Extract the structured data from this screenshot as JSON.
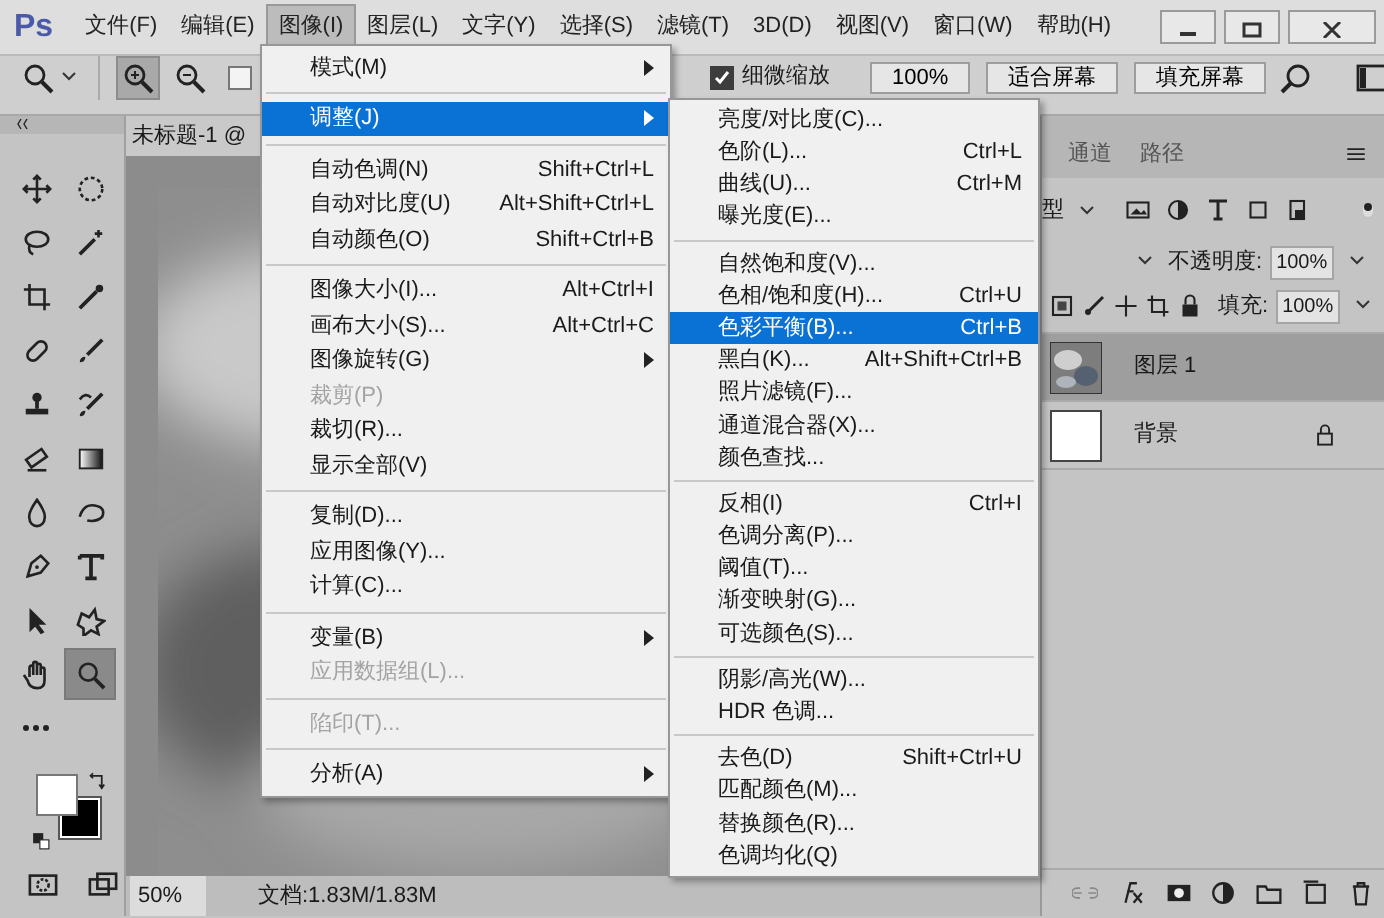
{
  "app_logo": "Ps",
  "menu_bar": [
    {
      "label": "文件(F)",
      "selected": false
    },
    {
      "label": "编辑(E)",
      "selected": false
    },
    {
      "label": "图像(I)",
      "selected": true
    },
    {
      "label": "图层(L)",
      "selected": false
    },
    {
      "label": "文字(Y)",
      "selected": false
    },
    {
      "label": "选择(S)",
      "selected": false
    },
    {
      "label": "滤镜(T)",
      "selected": false
    },
    {
      "label": "3D(D)",
      "selected": false
    },
    {
      "label": "视图(V)",
      "selected": false
    },
    {
      "label": "窗口(W)",
      "selected": false
    },
    {
      "label": "帮助(H)",
      "selected": false
    }
  ],
  "options_bar": {
    "zoom_buttons": [
      {
        "kind": "zoom-in",
        "selected": true
      },
      {
        "kind": "zoom-out",
        "selected": false
      }
    ],
    "checkbox_1": {
      "checked": false
    },
    "fine_zoom": {
      "label": "细微缩放",
      "checked": true
    },
    "buttons": [
      "100%",
      "适合屏幕",
      "填充屏幕"
    ]
  },
  "document_tab": "未标题-1 @",
  "tools": [
    {
      "kind": "move",
      "selected": false
    },
    {
      "kind": "marquee",
      "selected": false
    },
    {
      "kind": "lasso",
      "selected": false
    },
    {
      "kind": "wand",
      "selected": false
    },
    {
      "kind": "crop",
      "selected": false
    },
    {
      "kind": "eyedropper",
      "selected": false
    },
    {
      "kind": "bandage",
      "selected": false
    },
    {
      "kind": "brush",
      "selected": false
    },
    {
      "kind": "stamp",
      "selected": false
    },
    {
      "kind": "history",
      "selected": false
    },
    {
      "kind": "eraser",
      "selected": false
    },
    {
      "kind": "gradient",
      "selected": false
    },
    {
      "kind": "drop",
      "selected": false
    },
    {
      "kind": "swirl",
      "selected": false
    },
    {
      "kind": "pen",
      "selected": false
    },
    {
      "kind": "type",
      "selected": false
    },
    {
      "kind": "pointer",
      "selected": false
    },
    {
      "kind": "shape",
      "selected": false
    },
    {
      "kind": "hand",
      "selected": false
    },
    {
      "kind": "zoom",
      "selected": true
    },
    {
      "kind": "dots",
      "selected": false
    }
  ],
  "image_menu": {
    "groups": [
      [
        {
          "label": "模式(M)",
          "submenu": true,
          "disabled": false,
          "selected": false
        }
      ],
      [
        {
          "label": "调整(J)",
          "submenu": true,
          "disabled": false,
          "selected": true
        }
      ],
      [
        {
          "label": "自动色调(N)",
          "shortcut": "Shift+Ctrl+L",
          "disabled": false,
          "selected": false
        },
        {
          "label": "自动对比度(U)",
          "shortcut": "Alt+Shift+Ctrl+L",
          "disabled": false,
          "selected": false
        },
        {
          "label": "自动颜色(O)",
          "shortcut": "Shift+Ctrl+B",
          "disabled": false,
          "selected": false
        }
      ],
      [
        {
          "label": "图像大小(I)...",
          "shortcut": "Alt+Ctrl+I",
          "disabled": false,
          "selected": false
        },
        {
          "label": "画布大小(S)...",
          "shortcut": "Alt+Ctrl+C",
          "disabled": false,
          "selected": false
        },
        {
          "label": "图像旋转(G)",
          "submenu": true,
          "disabled": false,
          "selected": false
        },
        {
          "label": "裁剪(P)",
          "disabled": true,
          "selected": false
        },
        {
          "label": "裁切(R)...",
          "disabled": false,
          "selected": false
        },
        {
          "label": "显示全部(V)",
          "disabled": false,
          "selected": false
        }
      ],
      [
        {
          "label": "复制(D)...",
          "disabled": false,
          "selected": false
        },
        {
          "label": "应用图像(Y)...",
          "disabled": false,
          "selected": false
        },
        {
          "label": "计算(C)...",
          "disabled": false,
          "selected": false
        }
      ],
      [
        {
          "label": "变量(B)",
          "submenu": true,
          "disabled": false,
          "selected": false
        },
        {
          "label": "应用数据组(L)...",
          "disabled": true,
          "selected": false
        }
      ],
      [
        {
          "label": "陷印(T)...",
          "disabled": true,
          "selected": false
        }
      ],
      [
        {
          "label": "分析(A)",
          "submenu": true,
          "disabled": false,
          "selected": false
        }
      ]
    ]
  },
  "adjust_submenu": {
    "groups": [
      [
        {
          "label": "亮度/对比度(C)...",
          "disabled": false,
          "selected": false
        },
        {
          "label": "色阶(L)...",
          "shortcut": "Ctrl+L",
          "disabled": false,
          "selected": false
        },
        {
          "label": "曲线(U)...",
          "shortcut": "Ctrl+M",
          "disabled": false,
          "selected": false
        },
        {
          "label": "曝光度(E)...",
          "disabled": false,
          "selected": false
        }
      ],
      [
        {
          "label": "自然饱和度(V)...",
          "disabled": false,
          "selected": false
        },
        {
          "label": "色相/饱和度(H)...",
          "shortcut": "Ctrl+U",
          "disabled": false,
          "selected": false
        },
        {
          "label": "色彩平衡(B)...",
          "shortcut": "Ctrl+B",
          "disabled": false,
          "selected": true
        },
        {
          "label": "黑白(K)...",
          "shortcut": "Alt+Shift+Ctrl+B",
          "disabled": false,
          "selected": false
        },
        {
          "label": "照片滤镜(F)...",
          "disabled": false,
          "selected": false
        },
        {
          "label": "通道混合器(X)...",
          "disabled": false,
          "selected": false
        },
        {
          "label": "颜色查找...",
          "disabled": false,
          "selected": false
        }
      ],
      [
        {
          "label": "反相(I)",
          "shortcut": "Ctrl+I",
          "disabled": false,
          "selected": false
        },
        {
          "label": "色调分离(P)...",
          "disabled": false,
          "selected": false
        },
        {
          "label": "阈值(T)...",
          "disabled": false,
          "selected": false
        },
        {
          "label": "渐变映射(G)...",
          "disabled": false,
          "selected": false
        },
        {
          "label": "可选颜色(S)...",
          "disabled": false,
          "selected": false
        }
      ],
      [
        {
          "label": "阴影/高光(W)...",
          "disabled": false,
          "selected": false
        },
        {
          "label": "HDR 色调...",
          "disabled": false,
          "selected": false
        }
      ],
      [
        {
          "label": "去色(D)",
          "shortcut": "Shift+Ctrl+U",
          "disabled": false,
          "selected": false
        },
        {
          "label": "匹配颜色(M)...",
          "disabled": false,
          "selected": false
        },
        {
          "label": "替换颜色(R)...",
          "disabled": false,
          "selected": false
        },
        {
          "label": "色调均化(Q)",
          "disabled": false,
          "selected": false
        }
      ]
    ]
  },
  "layers_panel": {
    "tabs": [
      "通道",
      "路径"
    ],
    "filter_kind": "型",
    "opacity_label": "不透明度:",
    "opacity": "100%",
    "fill_label": "填充:",
    "fill": "100%",
    "layers": [
      {
        "name": "图层 1",
        "kind": "picture",
        "selected": true,
        "locked": false
      },
      {
        "name": "背景",
        "kind": "white",
        "selected": false,
        "locked": true
      }
    ]
  },
  "status_bar": {
    "zoom": "50%",
    "document": "文档:1.83M/1.83M"
  }
}
